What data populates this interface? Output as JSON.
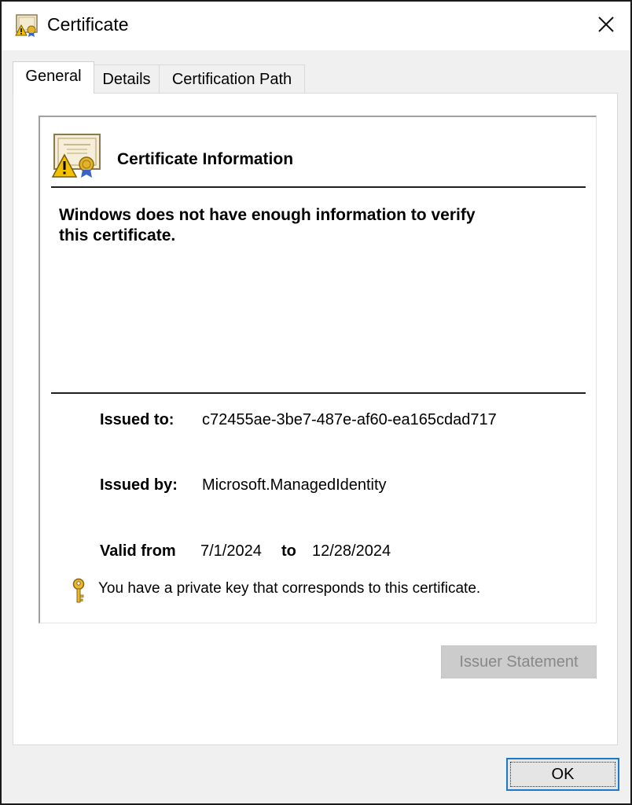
{
  "window": {
    "title": "Certificate",
    "close_glyph": "✕"
  },
  "tabs": [
    {
      "label": "General",
      "active": true
    },
    {
      "label": "Details",
      "active": false
    },
    {
      "label": "Certification Path",
      "active": false
    }
  ],
  "general": {
    "info_title": "Certificate Information",
    "warning_line1": "Windows does not have enough information to verify",
    "warning_line2": "this certificate.",
    "issued_to_label": "Issued to:",
    "issued_to_value": "c72455ae-3be7-487e-af60-ea165cdad717",
    "issued_by_label": "Issued by:",
    "issued_by_value": "Microsoft.ManagedIdentity",
    "valid_from_label": "Valid from",
    "valid_from_value": "7/1/2024",
    "valid_to_label": "to",
    "valid_to_value": "12/28/2024",
    "private_key_note": "You have a private key that corresponds to this certificate."
  },
  "buttons": {
    "issuer_statement": "Issuer Statement",
    "ok": "OK"
  },
  "icons": {
    "title": "certificate-warning-icon",
    "info": "certificate-warning-icon",
    "key": "key-icon",
    "close": "close-icon"
  },
  "colors": {
    "accent_focus": "#1979ca",
    "disabled_button": "#cccccc",
    "disabled_text": "#888888"
  }
}
